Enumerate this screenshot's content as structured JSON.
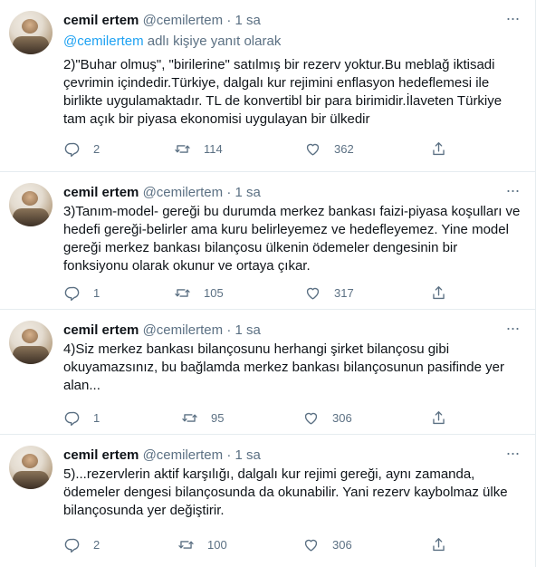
{
  "tweets": [
    {
      "name": "cemil ertem",
      "handle": "@cemilertem",
      "dot": "·",
      "time": "1 sa",
      "reply_mention": "@cemilertem",
      "reply_suffix": " adlı kişiye yanıt olarak",
      "text": "2)\"Buhar olmuş\", \"birilerine\" satılmış bir rezerv yoktur.Bu meblağ iktisadi çevrimin içindedir.Türkiye, dalgalı kur rejimini enflasyon hedeflemesi ile birlikte uygulamaktadır. TL de konvertibl bir para birimidir.İlaveten Türkiye tam açık bir piyasa ekonomisi uygulayan bir ülkedir",
      "replies": "2",
      "retweets": "114",
      "likes": "362"
    },
    {
      "name": "cemil ertem",
      "handle": "@cemilertem",
      "dot": "·",
      "time": "1 sa",
      "text": "3)Tanım-model- gereği bu durumda merkez bankası faizi-piyasa koşulları ve hedefi gereği-belirler ama kuru belirleyemez ve hedefleyemez. Yine model gereği merkez bankası bilançosu ülkenin ödemeler dengesinin bir fonksiyonu olarak okunur ve ortaya çıkar.",
      "replies": "1",
      "retweets": "105",
      "likes": "317"
    },
    {
      "name": "cemil ertem",
      "handle": "@cemilertem",
      "dot": "·",
      "time": "1 sa",
      "text": "4)Siz merkez bankası bilançosunu herhangi şirket bilançosu gibi okuyamazsınız, bu bağlamda merkez bankası bilançosunun pasifinde yer alan...",
      "replies": "1",
      "retweets": "95",
      "likes": "306"
    },
    {
      "name": "cemil ertem",
      "handle": "@cemilertem",
      "dot": "·",
      "time": "1 sa",
      "text": "5)...rezervlerin aktif karşılığı, dalgalı kur rejimi gereği, aynı zamanda, ödemeler dengesi bilançosunda da okunabilir. Yani rezerv kaybolmaz ülke bilançosunda yer değiştirir.",
      "replies": "2",
      "retweets": "100",
      "likes": "306"
    }
  ],
  "icons": {
    "reply": "reply-icon",
    "retweet": "retweet-icon",
    "like": "heart-icon",
    "share": "share-icon",
    "more": "more-icon"
  },
  "colors": {
    "accent": "#1da1f2",
    "secondary_text": "#5b7083",
    "divider": "#e6ecf0"
  }
}
